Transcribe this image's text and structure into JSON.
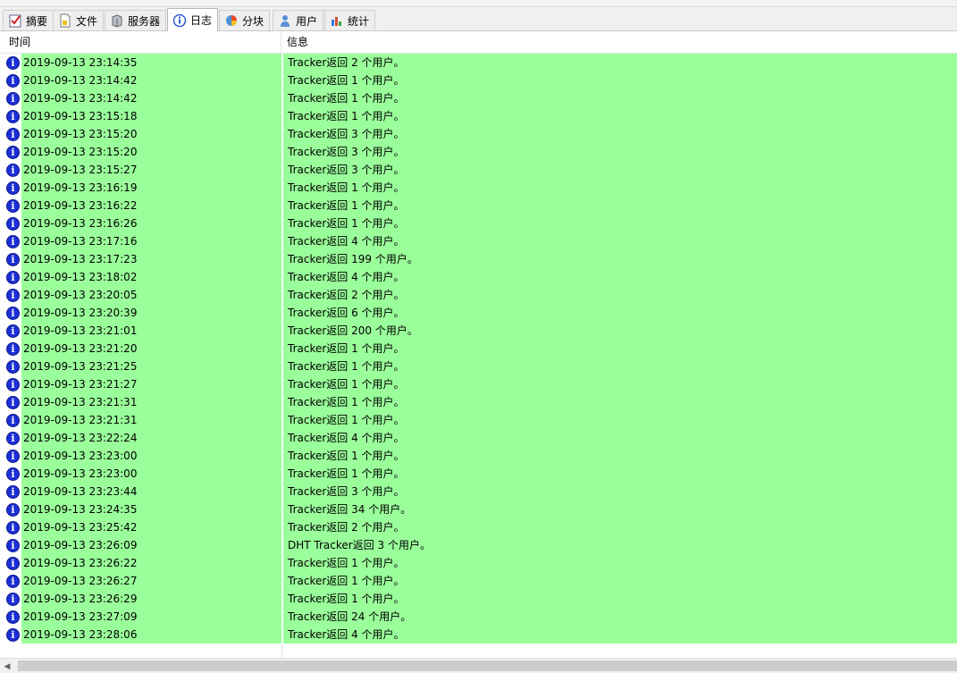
{
  "tabs": [
    {
      "label": "摘要",
      "icon": "checklist-icon",
      "active": false
    },
    {
      "label": "文件",
      "icon": "file-icon",
      "active": false
    },
    {
      "label": "服务器",
      "icon": "server-icon",
      "active": false
    },
    {
      "label": "日志",
      "icon": "info-log-icon",
      "active": true
    },
    {
      "label": "分块",
      "icon": "pie-chart-icon",
      "active": false
    },
    {
      "label": "用户",
      "icon": "user-icon",
      "active": false
    },
    {
      "label": "统计",
      "icon": "stats-icon",
      "active": false
    }
  ],
  "columns": {
    "time": "时间",
    "info": "信息"
  },
  "row_color": "#9afe9a",
  "log_rows": [
    {
      "time": "2019-09-13 23:14:35",
      "message": "Tracker返回 2 个用户。"
    },
    {
      "time": "2019-09-13 23:14:42",
      "message": "Tracker返回 1 个用户。"
    },
    {
      "time": "2019-09-13 23:14:42",
      "message": "Tracker返回 1 个用户。"
    },
    {
      "time": "2019-09-13 23:15:18",
      "message": "Tracker返回 1 个用户。"
    },
    {
      "time": "2019-09-13 23:15:20",
      "message": "Tracker返回 3 个用户。"
    },
    {
      "time": "2019-09-13 23:15:20",
      "message": "Tracker返回 3 个用户。"
    },
    {
      "time": "2019-09-13 23:15:27",
      "message": "Tracker返回 3 个用户。"
    },
    {
      "time": "2019-09-13 23:16:19",
      "message": "Tracker返回 1 个用户。"
    },
    {
      "time": "2019-09-13 23:16:22",
      "message": "Tracker返回 1 个用户。"
    },
    {
      "time": "2019-09-13 23:16:26",
      "message": "Tracker返回 1 个用户。"
    },
    {
      "time": "2019-09-13 23:17:16",
      "message": "Tracker返回 4 个用户。"
    },
    {
      "time": "2019-09-13 23:17:23",
      "message": "Tracker返回 199 个用户。"
    },
    {
      "time": "2019-09-13 23:18:02",
      "message": "Tracker返回 4 个用户。"
    },
    {
      "time": "2019-09-13 23:20:05",
      "message": "Tracker返回 2 个用户。"
    },
    {
      "time": "2019-09-13 23:20:39",
      "message": "Tracker返回 6 个用户。"
    },
    {
      "time": "2019-09-13 23:21:01",
      "message": "Tracker返回 200 个用户。"
    },
    {
      "time": "2019-09-13 23:21:20",
      "message": "Tracker返回 1 个用户。"
    },
    {
      "time": "2019-09-13 23:21:25",
      "message": "Tracker返回 1 个用户。"
    },
    {
      "time": "2019-09-13 23:21:27",
      "message": "Tracker返回 1 个用户。"
    },
    {
      "time": "2019-09-13 23:21:31",
      "message": "Tracker返回 1 个用户。"
    },
    {
      "time": "2019-09-13 23:21:31",
      "message": "Tracker返回 1 个用户。"
    },
    {
      "time": "2019-09-13 23:22:24",
      "message": "Tracker返回 4 个用户。"
    },
    {
      "time": "2019-09-13 23:23:00",
      "message": "Tracker返回 1 个用户。"
    },
    {
      "time": "2019-09-13 23:23:00",
      "message": "Tracker返回 1 个用户。"
    },
    {
      "time": "2019-09-13 23:23:44",
      "message": "Tracker返回 3 个用户。"
    },
    {
      "time": "2019-09-13 23:24:35",
      "message": "Tracker返回 34 个用户。"
    },
    {
      "time": "2019-09-13 23:25:42",
      "message": "Tracker返回 2 个用户。"
    },
    {
      "time": "2019-09-13 23:26:09",
      "message": "DHT Tracker返回 3 个用户。"
    },
    {
      "time": "2019-09-13 23:26:22",
      "message": "Tracker返回 1 个用户。"
    },
    {
      "time": "2019-09-13 23:26:27",
      "message": "Tracker返回 1 个用户。"
    },
    {
      "time": "2019-09-13 23:26:29",
      "message": "Tracker返回 1 个用户。"
    },
    {
      "time": "2019-09-13 23:27:09",
      "message": "Tracker返回 24 个用户。"
    },
    {
      "time": "2019-09-13 23:28:06",
      "message": "Tracker返回 4 个用户。"
    }
  ]
}
